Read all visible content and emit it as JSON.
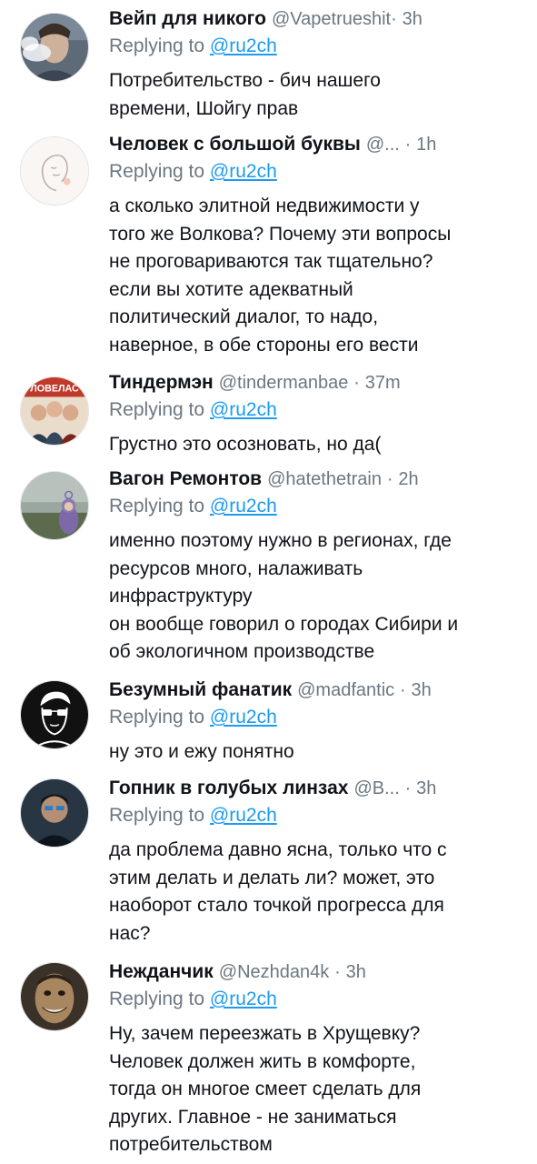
{
  "reply_prefix": "Replying to",
  "reply_handle": "@ru2ch",
  "tweets": [
    {
      "name": "Вейп для никого",
      "handle": "@Vapetrueshit",
      "sep": "·",
      "time": "3h",
      "avatar_icon": "vape-smoke-avatar",
      "lines": [
        "Потребительство - бич нашего",
        "времени, Шойгу прав"
      ]
    },
    {
      "name": "Человек с большой буквы",
      "handle": "@...",
      "sep": "·",
      "time": "1h",
      "avatar_icon": "line-art-face-avatar",
      "lines": [
        "а сколько элитной недвижимости у",
        "того же Волкова? Почему эти вопросы",
        "не проговариваются так тщательно?",
        "если вы хотите адекватный",
        "политический диалог, то надо,",
        "наверное, в обе стороны его вести"
      ]
    },
    {
      "name": "Тиндермэн",
      "handle": "@tindermanbae",
      "sep": "·",
      "time": "37m",
      "avatar_icon": "poster-avatar",
      "avatar_text": "ЛОВЕЛАС",
      "lines": [
        "Грустно это осозновать, но да("
      ]
    },
    {
      "name": "Вагон Ремонтов",
      "handle": "@hatethetrain",
      "sep": "·",
      "time": "2h",
      "avatar_icon": "teletubby-avatar",
      "lines": [
        "именно поэтому нужно в регионах, где",
        "ресурсов много, налаживать",
        "инфраструктуру",
        "он вообще говорил о городах Сибири и",
        "об экологичном производстве"
      ]
    },
    {
      "name": "Безумный фанатик",
      "handle": "@madfantic",
      "sep": "·",
      "time": "3h",
      "avatar_icon": "sunglasses-face-avatar",
      "lines": [
        "ну это и ежу понятно"
      ]
    },
    {
      "name": "Гопник в голубых линзах",
      "handle": "@B...",
      "sep": "·",
      "time": "3h",
      "avatar_icon": "dark-photo-avatar",
      "lines": [
        "да проблема давно ясна, только что с",
        "этим делать и делать ли? может, это",
        "наоборот стало точкой прогресса для",
        "нас?"
      ]
    },
    {
      "name": "Нежданчик",
      "handle": "@Nezhdan4k",
      "sep": "·",
      "time": "3h",
      "avatar_icon": "grinning-face-avatar",
      "lines": [
        "Ну, зачем переезжать в Хрущевку?",
        "Человек должен жить в комфорте,",
        "тогда он многое смеет сделать для",
        "других. Главное - не заниматься",
        "потребительством"
      ]
    }
  ]
}
